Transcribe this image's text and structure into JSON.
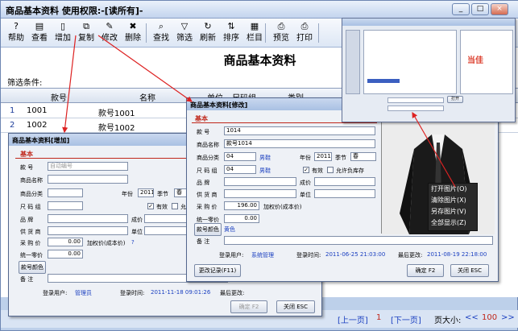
{
  "window": {
    "title": "商品基本资料   使用权限:-[读所有]-",
    "min": "_",
    "max": "□",
    "close": "×"
  },
  "toolbar": [
    {
      "label": "帮助",
      "icon": "?"
    },
    {
      "label": "查看",
      "icon": "▤"
    },
    {
      "label": "增加",
      "icon": "▯"
    },
    {
      "label": "复制",
      "icon": "⧉"
    },
    {
      "label": "修改",
      "icon": "✎"
    },
    {
      "label": "删除",
      "icon": "✖"
    },
    {
      "label": "查找",
      "icon": "⌕"
    },
    {
      "label": "筛选",
      "icon": "▽"
    },
    {
      "label": "刷新",
      "icon": "↻"
    },
    {
      "label": "排序",
      "icon": "⇅"
    },
    {
      "label": "栏目",
      "icon": "▦"
    },
    {
      "label": "预览",
      "icon": "⎙"
    },
    {
      "label": "打印",
      "icon": "⎙"
    }
  ],
  "heading": "商品基本资料",
  "filter": "筛选条件:",
  "grid": {
    "headers": [
      "款号",
      "名称",
      "单位",
      "尺码组",
      "类别"
    ],
    "rows": [
      {
        "no": "1",
        "code": "1001",
        "name": "款号1001"
      },
      {
        "no": "2",
        "code": "1002",
        "name": "款号1002"
      }
    ]
  },
  "pager": {
    "prev": "[上一页]",
    "page": "1",
    "next": "[下一页]",
    "size_label": "页大小:",
    "size": "100"
  },
  "add_dialog": {
    "title": "商品基本资料[增加]",
    "section": "基本",
    "code_label": "款    号",
    "code_placeholder": "自动编号",
    "name_label": "商品名称",
    "cat_label": "商品分类",
    "year_label": "年份",
    "year": "2011",
    "season_label": "季节",
    "season": "春",
    "size_label": "尺 码 组",
    "valid": "有效",
    "allow_neg": "允许负库存",
    "brand_label": "品    牌",
    "cost_label": "成价",
    "supplier_label": "供 货 商",
    "unit_label": "单位",
    "purchase_label": "采 购 价",
    "purchase": "0.00",
    "markup": "加权价(成本价)",
    "markup_val": "?",
    "retail_label": "统一零价",
    "retail": "0.00",
    "color_btn": "款号颜色",
    "note_label": "备    注",
    "user_label": "登录用户:",
    "user": "管理员",
    "time_label": "登录时间:",
    "time": "2011-11-18 09:01:26",
    "changed_label": "最后更改:",
    "ok": "确定 F2",
    "close": "关闭 ESC"
  },
  "edit_dialog": {
    "title": "商品基本资料[修改]",
    "section": "基本",
    "code_label": "款    号",
    "code": "1014",
    "name_label": "商品名称",
    "name": "款号1014",
    "cat_label": "商品分类",
    "cat": "04",
    "cat_name": "男鞋",
    "year_label": "年份",
    "year": "2011",
    "season_label": "季节",
    "season": "春",
    "size_label": "尺 码 组",
    "size": "04",
    "size_name": "男鞋",
    "valid": "有效",
    "allow_neg": "允许负库存",
    "brand_label": "品    牌",
    "cost_label": "成价",
    "supplier_label": "供 货 商",
    "unit_label": "单位",
    "purchase_label": "采 购 价",
    "purchase": "196.00",
    "markup": "加权价(成本价)",
    "retail_label": "统一零价",
    "retail": "0.00",
    "color_btn": "款号颜色",
    "color": "黄色",
    "note_label": "备    注",
    "user_label": "登录用户:",
    "user": "系统管理",
    "time_label": "登录时间:",
    "time": "2011-06-25 21:03:00",
    "changed_label": "最后更改:",
    "changed": "2011-08-19 22:18:00",
    "log_btn": "更改记录(F11)",
    "ok": "确定 F2",
    "close": "关闭 ESC"
  },
  "context_menu": [
    "打开图片(O)",
    "清除图片(X)",
    "另存图片(V)",
    "全部显示(Z)"
  ],
  "file_dialog": {
    "label": "打开",
    "logo": "当佳"
  }
}
